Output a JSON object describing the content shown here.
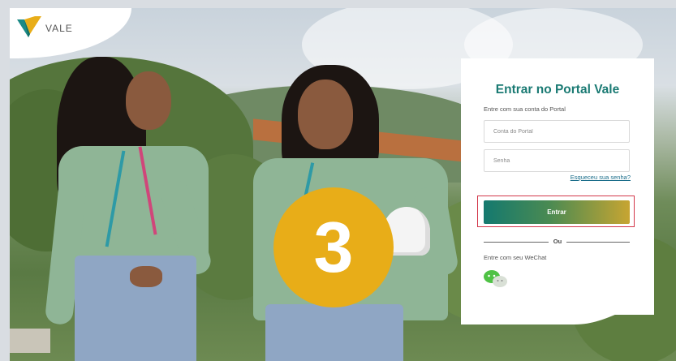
{
  "brand": {
    "logo_text": "VALE",
    "colors": {
      "teal": "#1a7a73",
      "gold": "#e8ad18",
      "highlight": "#d3374a"
    }
  },
  "login": {
    "title": "Entrar no Portal Vale",
    "subtitle": "Entre com sua conta do Portal",
    "account_placeholder": "Conta do Portal",
    "password_placeholder": "Senha",
    "forgot_link": "Esqueceu sua senha?",
    "submit_label": "Entrar",
    "or_label": "Ou",
    "wechat_label": "Entre com seu WeChat",
    "wechat_icon": "wechat-icon"
  },
  "step_badge": {
    "number": "3"
  }
}
